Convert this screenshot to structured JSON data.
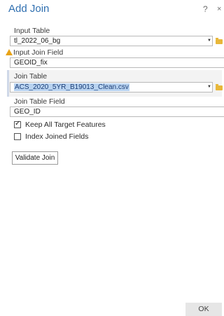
{
  "dialog": {
    "title": "Add Join",
    "help": "?",
    "close": "×"
  },
  "fields": {
    "input_table": {
      "label": "Input Table",
      "value": "tl_2022_06_bg"
    },
    "input_join_field": {
      "label": "Input Join Field",
      "value": "GEOID_fix"
    },
    "join_table": {
      "label": "Join Table",
      "value": "ACS_2020_5YR_B19013_Clean.csv"
    },
    "join_table_field": {
      "label": "Join Table Field",
      "value": "GEO_ID"
    }
  },
  "options": {
    "keep_all": {
      "label": "Keep All Target Features",
      "checked": true
    },
    "index_joined": {
      "label": "Index Joined Fields",
      "checked": false
    }
  },
  "buttons": {
    "validate": "Validate Join",
    "ok": "OK"
  },
  "icons": {
    "warning": "warning-icon",
    "folder": "folder-icon",
    "dropdown": "chevron-down-icon"
  }
}
